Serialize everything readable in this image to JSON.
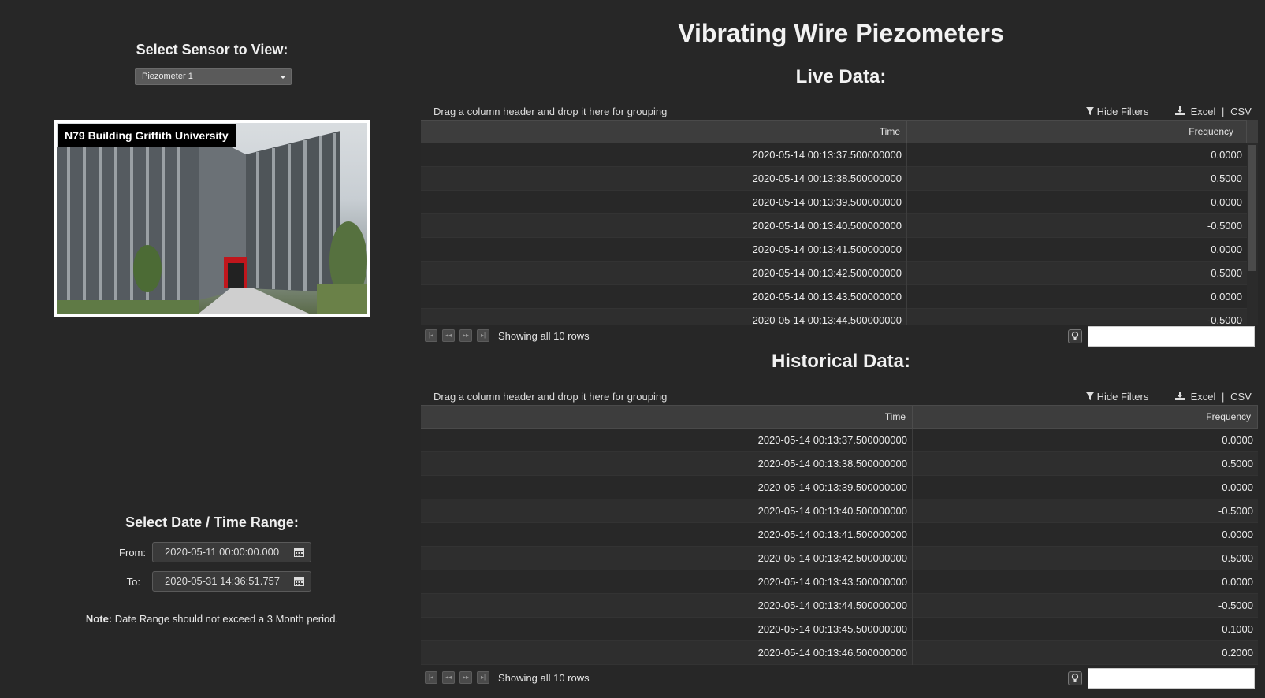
{
  "app": {
    "title": "Vibrating Wire Piezometers"
  },
  "sensor": {
    "heading": "Select Sensor to View:",
    "selected": "Piezometer 1"
  },
  "photo": {
    "caption": "N79 Building Griffith University"
  },
  "date_range": {
    "heading": "Select Date / Time Range:",
    "from_label": "From:",
    "from_value": "2020-05-11 00:00:00.000",
    "to_label": "To:",
    "to_value": "2020-05-31 14:36:51.757",
    "note_bold": "Note:",
    "note_text": "Date Range should not exceed a 3 Month period."
  },
  "live": {
    "heading": "Live Data:",
    "group_hint": "Drag a column header and drop it here for grouping",
    "hide_filters": "Hide Filters",
    "excel": "Excel",
    "sep": "|",
    "csv": "CSV",
    "columns": [
      "Time",
      "Frequency"
    ],
    "rows": [
      [
        "2020-05-14 00:13:37.500000000",
        "0.0000"
      ],
      [
        "2020-05-14 00:13:38.500000000",
        "0.5000"
      ],
      [
        "2020-05-14 00:13:39.500000000",
        "0.0000"
      ],
      [
        "2020-05-14 00:13:40.500000000",
        "-0.5000"
      ],
      [
        "2020-05-14 00:13:41.500000000",
        "0.0000"
      ],
      [
        "2020-05-14 00:13:42.500000000",
        "0.5000"
      ],
      [
        "2020-05-14 00:13:43.500000000",
        "0.0000"
      ],
      [
        "2020-05-14 00:13:44.500000000",
        "-0.5000"
      ]
    ],
    "pager_info": "Showing all 10 rows"
  },
  "historical": {
    "heading": "Historical Data:",
    "group_hint": "Drag a column header and drop it here for grouping",
    "hide_filters": "Hide Filters",
    "excel": "Excel",
    "sep": "|",
    "csv": "CSV",
    "columns": [
      "Time",
      "Frequency"
    ],
    "rows": [
      [
        "2020-05-14 00:13:37.500000000",
        "0.0000"
      ],
      [
        "2020-05-14 00:13:38.500000000",
        "0.5000"
      ],
      [
        "2020-05-14 00:13:39.500000000",
        "0.0000"
      ],
      [
        "2020-05-14 00:13:40.500000000",
        "-0.5000"
      ],
      [
        "2020-05-14 00:13:41.500000000",
        "0.0000"
      ],
      [
        "2020-05-14 00:13:42.500000000",
        "0.5000"
      ],
      [
        "2020-05-14 00:13:43.500000000",
        "0.0000"
      ],
      [
        "2020-05-14 00:13:44.500000000",
        "-0.5000"
      ],
      [
        "2020-05-14 00:13:45.500000000",
        "0.1000"
      ],
      [
        "2020-05-14 00:13:46.500000000",
        "0.2000"
      ]
    ],
    "pager_info": "Showing all 10 rows"
  }
}
